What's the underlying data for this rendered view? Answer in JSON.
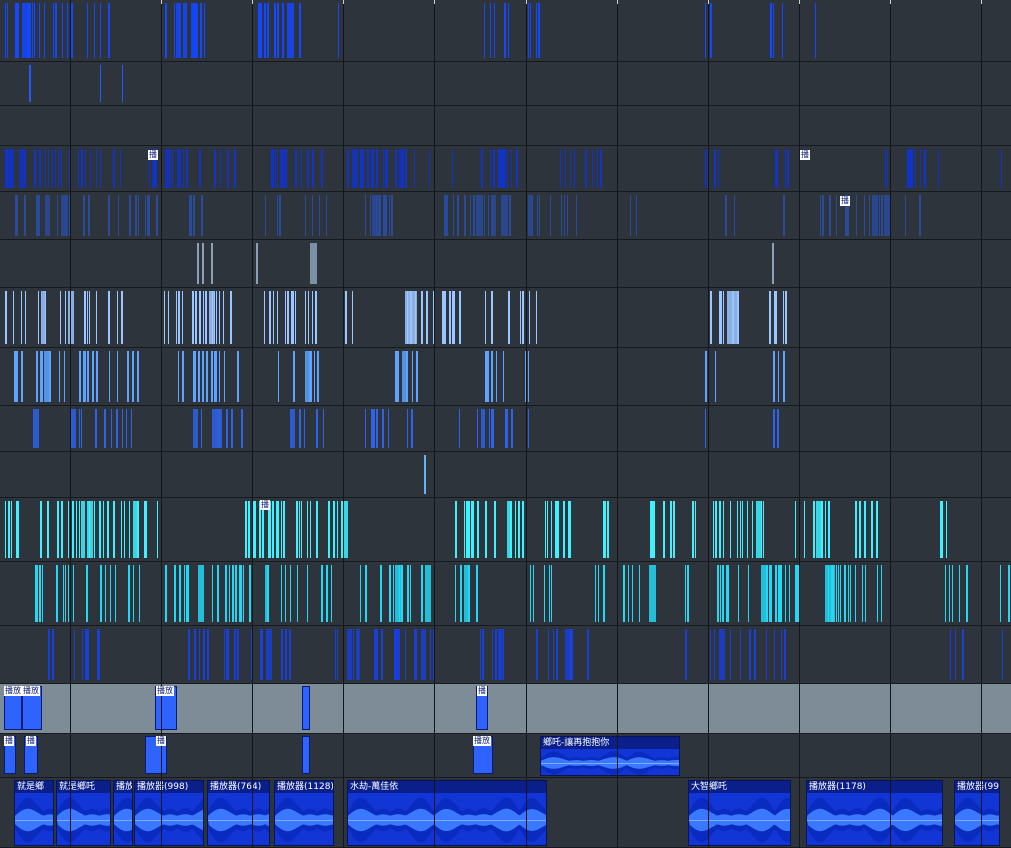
{
  "colors": {
    "background": "#2d343c",
    "selected_lane": "#7e8c98",
    "clip_header": "#0b1f8a",
    "clip_body": "#1236d6",
    "accent_blue": "#1a4fff",
    "pale_blue": "#9cc6ff",
    "cyan": "#3ef1ff"
  },
  "audio_clips": [
    {
      "label": "就是鄉"
    },
    {
      "label": "就是鄉吒"
    },
    {
      "label": "播放"
    },
    {
      "label": "播放器(998)"
    },
    {
      "label": "播放器(764)"
    },
    {
      "label": "播放器(1128)"
    },
    {
      "label": "水劫-萬佳依"
    },
    {
      "label": "大智鄉吒"
    },
    {
      "label": "播放器(1178)"
    },
    {
      "label": "播放器(99"
    },
    {
      "label": "鄉吒-讓再抱抱你"
    }
  ],
  "short_tags": [
    "播",
    "播",
    "播",
    "播",
    "播",
    "播放",
    "播放",
    "播放",
    "播放"
  ]
}
